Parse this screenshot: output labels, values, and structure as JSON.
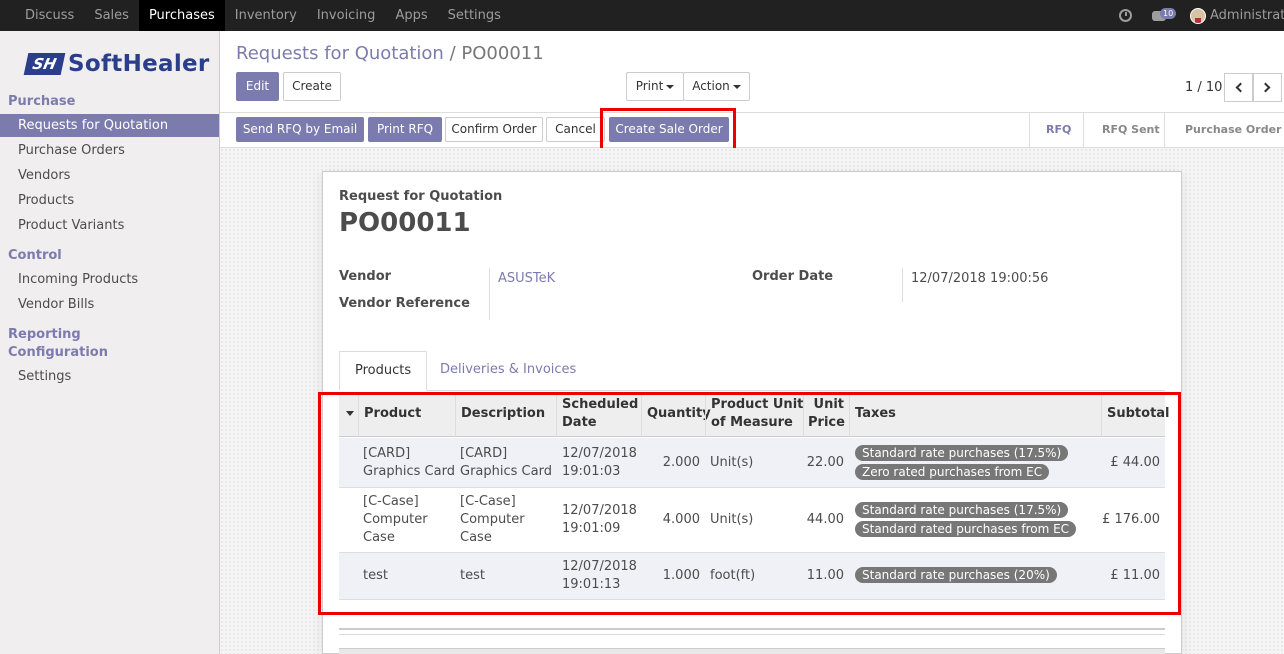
{
  "topbar": {
    "apps": [
      "Discuss",
      "Sales",
      "Purchases",
      "Inventory",
      "Invoicing",
      "Apps",
      "Settings"
    ],
    "active_app": "Purchases",
    "chat_count": "10",
    "user": "Administrator"
  },
  "sidebar": {
    "logo_mark": "SH",
    "logo_text": "SoftHealer",
    "sections": [
      {
        "title": "Purchase",
        "items": [
          "Requests for Quotation",
          "Purchase Orders",
          "Vendors",
          "Products",
          "Product Variants"
        ]
      },
      {
        "title": "Control",
        "items": [
          "Incoming Products",
          "Vendor Bills"
        ]
      },
      {
        "title": "Reporting",
        "items": []
      },
      {
        "title": "Configuration",
        "items": [
          "Settings"
        ]
      }
    ],
    "active_item": "Requests for Quotation"
  },
  "breadcrumb": {
    "parent": "Requests for Quotation",
    "separator": "/",
    "current": "PO00011"
  },
  "control": {
    "edit": "Edit",
    "create": "Create",
    "print": "Print",
    "action": "Action",
    "pager": "1 / 10"
  },
  "statusbar": {
    "buttons": [
      "Send RFQ by Email",
      "Print RFQ",
      "Confirm Order",
      "Cancel",
      "Create Sale Order"
    ],
    "stages": [
      "RFQ",
      "RFQ Sent",
      "Purchase Order"
    ],
    "active_stage": "RFQ"
  },
  "form": {
    "doc_type": "Request for Quotation",
    "name": "PO00011",
    "vendor_label": "Vendor",
    "vendor": "ASUSTeK",
    "vendor_ref_label": "Vendor Reference",
    "order_date_label": "Order Date",
    "order_date": "12/07/2018 19:00:56"
  },
  "tabs": [
    "Products",
    "Deliveries & Invoices"
  ],
  "table": {
    "headers": {
      "product": "Product",
      "description": "Description",
      "scheduled_1": "Scheduled",
      "scheduled_2": "Date",
      "quantity": "Quantity",
      "uom_1": "Product Unit",
      "uom_2": "of Measure",
      "price_1": "Unit",
      "price_2": "Price",
      "taxes": "Taxes",
      "subtotal": "Subtotal"
    },
    "rows": [
      {
        "product": [
          "[CARD]",
          "Graphics Card"
        ],
        "description": [
          "[CARD]",
          "Graphics Card"
        ],
        "date": [
          "12/07/2018",
          "19:01:03"
        ],
        "quantity": "2.000",
        "uom": "Unit(s)",
        "price": "22.00",
        "taxes": [
          "Standard rate purchases (17.5%)",
          "Zero rated purchases from EC"
        ],
        "subtotal": "£ 44.00"
      },
      {
        "product": [
          "[C-Case]",
          "Computer",
          "Case"
        ],
        "description": [
          "[C-Case]",
          "Computer",
          "Case"
        ],
        "date": [
          "12/07/2018",
          "19:01:09"
        ],
        "quantity": "4.000",
        "uom": "Unit(s)",
        "price": "44.00",
        "taxes": [
          "Standard rate purchases (17.5%)",
          "Standard rated purchases from EC"
        ],
        "subtotal": "£ 176.00"
      },
      {
        "product": [
          "test"
        ],
        "description": [
          "test"
        ],
        "date": [
          "12/07/2018",
          "19:01:13"
        ],
        "quantity": "1.000",
        "uom": "foot(ft)",
        "price": "11.00",
        "taxes": [
          "Standard rate purchases (20%)"
        ],
        "subtotal": "£ 11.00"
      }
    ]
  },
  "colors": {
    "brand": "#7c7bad",
    "highlight": "#e00000",
    "topbar": "#212121"
  }
}
